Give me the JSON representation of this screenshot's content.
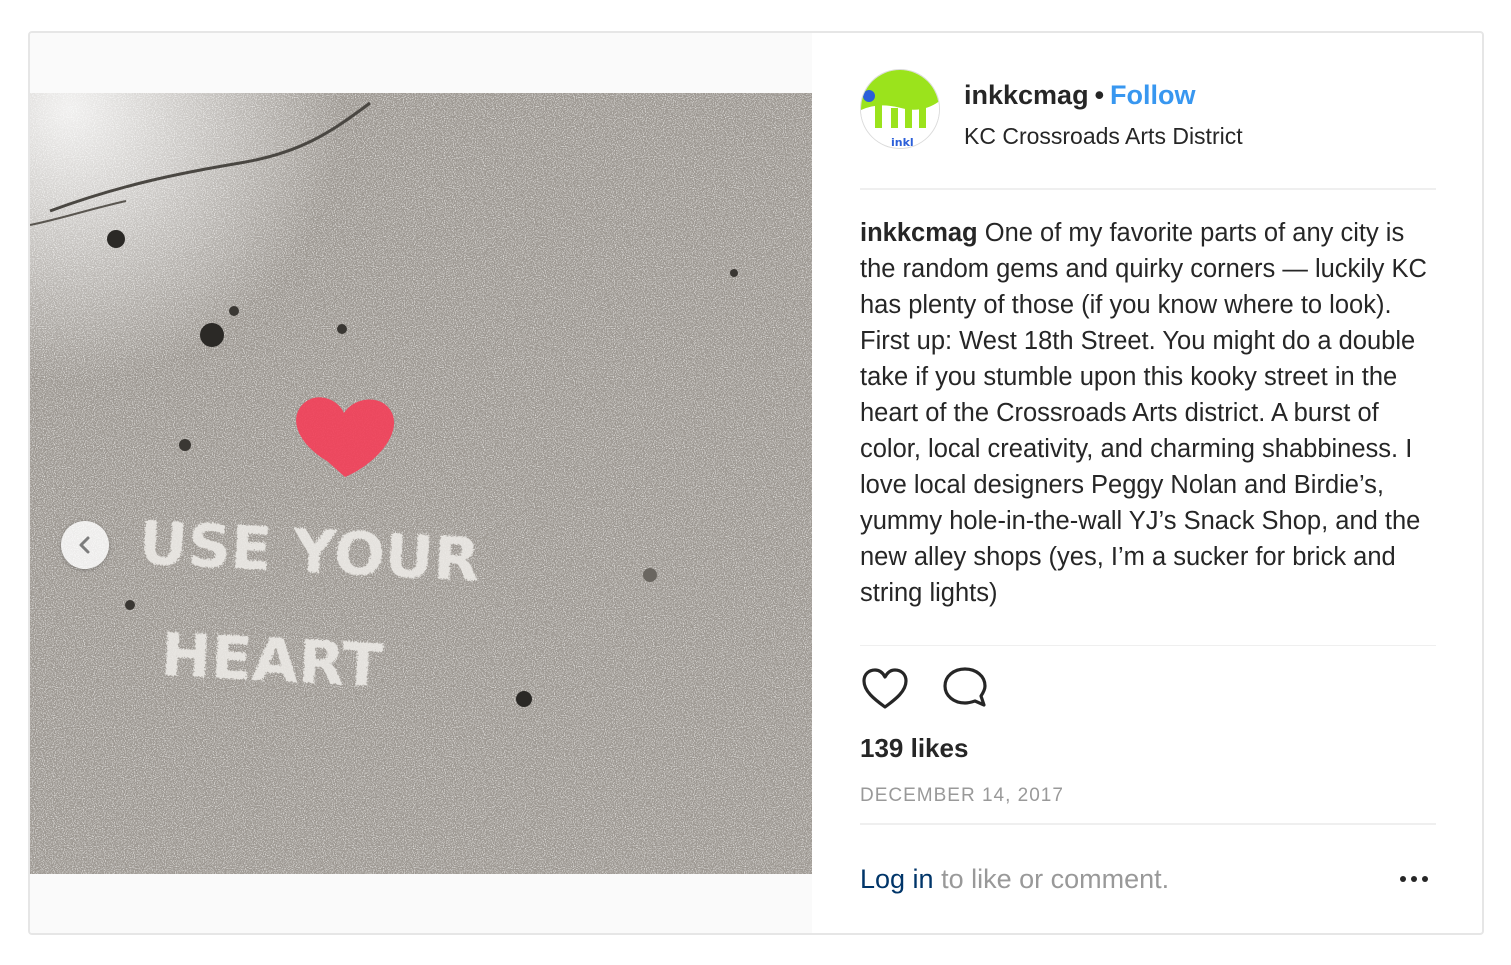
{
  "post": {
    "username": "inkkcmag",
    "separator": "•",
    "follow_label": "Follow",
    "location": "KC Crossroads Arts District",
    "avatar_text": "inkl",
    "caption_username": "inkkcmag",
    "caption_text": "One of my favorite parts of any city is the random gems and quirky corners — luckily KC has plenty of those (if you know where to look). First up: West 18th Street. You might do a double take if you stumble upon this kooky street in the heart of the Crossroads Arts district. A burst of color, local creativity, and charming shabbiness. I love local designers Peggy Nolan and Birdie’s, yummy hole-in-the-wall YJ’s Snack Shop, and the new alley shops (yes, I’m a sucker for brick and string lights)",
    "likes": "139 likes",
    "date": "DECEMBER 14, 2017",
    "login_link": "Log in",
    "login_rest": " to like or comment."
  },
  "photo": {
    "stencil_line1": "USE YOUR",
    "stencil_line2": "HEART"
  },
  "icons": {
    "like": "heart-outline-icon",
    "comment": "speech-bubble-icon",
    "more": "ellipsis-icon",
    "prev": "chevron-left-icon"
  },
  "colors": {
    "follow": "#3897f0",
    "link": "#003569",
    "muted": "#999999",
    "heart_paint": "#f2415a",
    "avatar_green": "#9be31c",
    "avatar_blue": "#2b5fd9"
  }
}
